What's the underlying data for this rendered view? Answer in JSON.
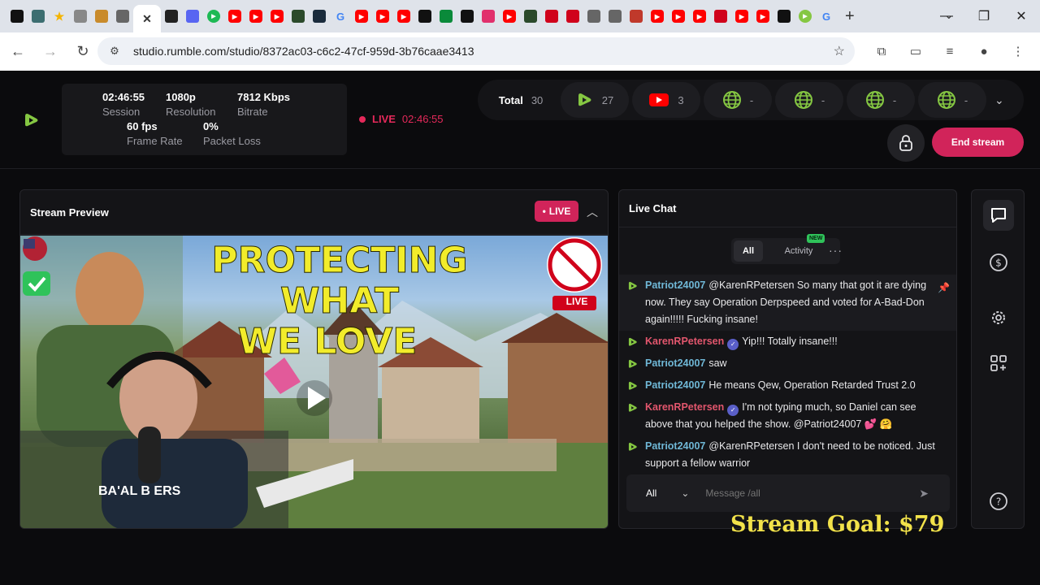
{
  "browser": {
    "url": "studio.rumble.com/studio/8372ac03-c6c2-47cf-959d-3b76caae3413",
    "tabs": [
      {
        "icon": "notion-icon",
        "color": "#111111"
      },
      {
        "icon": "puzzle-icon",
        "color": "#3c6e71"
      },
      {
        "icon": "star-icon",
        "color": "#f4b400"
      },
      {
        "icon": "compass-icon",
        "color": "#888888"
      },
      {
        "icon": "avatar-icon",
        "color": "#c98b2b"
      },
      {
        "icon": "gear-icon",
        "color": "#666666"
      },
      {
        "icon": "close-icon",
        "color": "#333333"
      },
      {
        "icon": "play-circle-icon",
        "color": "#222222"
      },
      {
        "icon": "podcast-icon",
        "color": "#5865f2"
      },
      {
        "icon": "spotify-icon",
        "color": "#1db954"
      },
      {
        "icon": "youtube-icon",
        "color": "#ff0000"
      },
      {
        "icon": "youtube-icon",
        "color": "#ff0000"
      },
      {
        "icon": "youtube-icon",
        "color": "#ff0000"
      },
      {
        "icon": "app-icon",
        "color": "#2b4a2b"
      },
      {
        "icon": "chart-icon",
        "color": "#1a2b3c"
      },
      {
        "icon": "google-icon",
        "color": "#4285f4"
      },
      {
        "icon": "youtube-icon",
        "color": "#ff0000"
      },
      {
        "icon": "youtube-icon",
        "color": "#ff0000"
      },
      {
        "icon": "youtube-icon",
        "color": "#ff0000"
      },
      {
        "icon": "kick-icon",
        "color": "#111111"
      },
      {
        "icon": "hi-icon",
        "color": "#0a8a3a"
      },
      {
        "icon": "amazon-icon",
        "color": "#111111"
      },
      {
        "icon": "instagram-icon",
        "color": "#e1306c"
      },
      {
        "icon": "youtube-icon",
        "color": "#ff0000"
      },
      {
        "icon": "app-icon",
        "color": "#2b4a2b"
      },
      {
        "icon": "refresh-icon",
        "color": "#d0021b"
      },
      {
        "icon": "flag-icon",
        "color": "#d0021b"
      },
      {
        "icon": "discord-icon",
        "color": "#666666"
      },
      {
        "icon": "discord-icon",
        "color": "#666666"
      },
      {
        "icon": "s-icon",
        "color": "#c0392b"
      },
      {
        "icon": "youtube-icon",
        "color": "#ff0000"
      },
      {
        "icon": "youtube-icon",
        "color": "#ff0000"
      },
      {
        "icon": "youtube-icon",
        "color": "#ff0000"
      },
      {
        "icon": "refresh-icon",
        "color": "#d0021b"
      },
      {
        "icon": "youtube-icon",
        "color": "#ff0000"
      },
      {
        "icon": "youtube-icon",
        "color": "#ff0000"
      },
      {
        "icon": "triangle-icon",
        "color": "#111111"
      },
      {
        "icon": "rumble-icon",
        "color": "#85c742"
      },
      {
        "icon": "google-icon",
        "color": "#4285f4"
      }
    ],
    "new_tab": "+"
  },
  "header": {
    "stats": [
      {
        "value": "02:46:55",
        "label": "Session"
      },
      {
        "value": "1080p",
        "label": "Resolution"
      },
      {
        "value": "7812 Kbps",
        "label": "Bitrate"
      },
      {
        "value": "60 fps",
        "label": "Frame Rate"
      },
      {
        "value": "0%",
        "label": "Packet Loss"
      }
    ],
    "live_label": "LIVE",
    "live_time": "02:46:55",
    "total_label": "Total",
    "total_count": "30",
    "platforms": [
      {
        "icon": "rumble-play-icon",
        "count": "27",
        "color": "#85c742"
      },
      {
        "icon": "youtube-icon",
        "count": "3",
        "color": "#ff0000"
      },
      {
        "icon": "globe-icon",
        "count": "-",
        "color": "#85c742"
      },
      {
        "icon": "globe-icon",
        "count": "-",
        "color": "#85c742"
      },
      {
        "icon": "globe-icon",
        "count": "-",
        "color": "#85c742"
      },
      {
        "icon": "globe-icon",
        "count": "-",
        "color": "#85c742"
      }
    ],
    "end_stream_label": "End stream"
  },
  "preview": {
    "title": "Stream Preview",
    "live_label": "LIVE",
    "thumbnail_line1": "PROTECTING WHAT",
    "thumbnail_line2": "WE LOVE",
    "thumb_live": "LIVE",
    "shirt_text": "BA'AL B    ERS"
  },
  "chat": {
    "title": "Live Chat",
    "tab_all": "All",
    "tab_activity": "Activity",
    "new_badge": "NEW",
    "messages": [
      {
        "user": "Patriot24007",
        "user_class": "u-green",
        "verified": false,
        "text": "@KarenRPetersen So many that got it are dying now. They say Operation Derpspeed and voted for A-Bad-Don again!!!!! Fucking insane!",
        "pinned": true
      },
      {
        "user": "KarenRPetersen",
        "user_class": "u-red",
        "verified": true,
        "text": "Yip!!! Totally insane!!!",
        "pinned": false
      },
      {
        "user": "Patriot24007",
        "user_class": "u-green",
        "verified": false,
        "text": "saw",
        "pinned": false
      },
      {
        "user": "Patriot24007",
        "user_class": "u-green",
        "verified": false,
        "text": "He means Qew, Operation Retarded Trust 2.0",
        "pinned": false
      },
      {
        "user": "KarenRPetersen",
        "user_class": "u-red",
        "verified": true,
        "text": "I'm not typing much, so Daniel can see above that you helped the show. @Patriot24007 💕 🤗",
        "pinned": false
      },
      {
        "user": "Patriot24007",
        "user_class": "u-green",
        "verified": false,
        "text": "@KarenRPetersen I don't need to be noticed. Just support a fellow warrior",
        "pinned": false
      }
    ],
    "composer_select": "All",
    "composer_placeholder": "Message /all"
  },
  "overlay": {
    "stream_goal": "Stream Goal: $79"
  },
  "colors": {
    "accent": "#85c742",
    "live": "#e5295a",
    "end_button": "#d1245a",
    "goal": "#f2e24a"
  }
}
